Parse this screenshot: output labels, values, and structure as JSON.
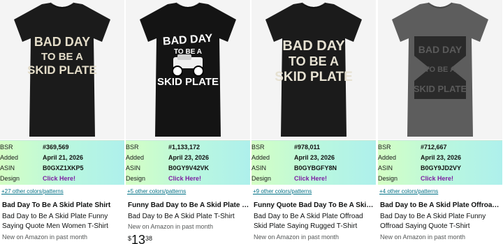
{
  "products": [
    {
      "shirt_color": "#1b1b1b",
      "design_lines": [
        "BAD DAY",
        "TO BE A",
        "SKID PLATE"
      ],
      "stats": {
        "bsr_label": "BSR",
        "bsr": "#369,569",
        "added_label": "Added",
        "added": "April 21, 2026",
        "asin_label": "ASIN",
        "asin": "B0GXZ1XKP5",
        "design_label": "Design",
        "design_link": "Click Here!"
      },
      "colors_link": "+27 other colors/patterns",
      "title_bold": "Bad Day To Be A Skid Plate Shirt",
      "title_sub": "Bad Day to Be A Skid Plate Funny Saying Quote Men Women T-Shirt",
      "new_text": "New on Amazon in past month"
    },
    {
      "shirt_color": "#141414",
      "design_lines": [
        "BAD DAY",
        "TO BE A",
        "SKID PLATE"
      ],
      "stats": {
        "bsr_label": "BSR",
        "bsr": "#1,133,172",
        "added_label": "Added",
        "added": "April 23, 2026",
        "asin_label": "ASIN",
        "asin": "B0GY9V42VK",
        "design_label": "Design",
        "design_link": "Click Here!"
      },
      "colors_link": "+5 other colors/patterns",
      "title_bold": "Funny Bad Day to Be A Skid Plate Tee",
      "title_sub": "Bad Day to Be A Skid Plate T-Shirt",
      "new_text": "New on Amazon in past month",
      "price": {
        "symbol": "$",
        "whole": "13",
        "fraction": "38"
      }
    },
    {
      "shirt_color": "#1b1b1b",
      "design_lines": [
        "BAD DAY",
        "TO BE A",
        "SKID PLATE"
      ],
      "stats": {
        "bsr_label": "BSR",
        "bsr": "#978,011",
        "added_label": "Added",
        "added": "April 23, 2026",
        "asin_label": "ASIN",
        "asin": "B0GYBGFY8N",
        "design_label": "Design",
        "design_link": "Click Here!"
      },
      "colors_link": "+9 other colors/patterns",
      "title_bold": "Funny Quote Bad Day To Be A Skid Plate Shirt",
      "title_sub": "Bad Day to Be A Skid Plate Offroad Skid Plate Saying Rugged T-Shirt",
      "new_text": "New on Amazon in past month"
    },
    {
      "shirt_color": "#5d5d5d",
      "design_lines": [
        "BAD DAY",
        "TO BE A",
        "SKID PLATE"
      ],
      "stats": {
        "bsr_label": "BSR",
        "bsr": "#712,667",
        "added_label": "Added",
        "added": "April 23, 2026",
        "asin_label": "ASIN",
        "asin": "B0GY9JD2VY",
        "design_label": "Design",
        "design_link": "Click Here!"
      },
      "colors_link": "+4 other colors/patterns",
      "title_bold": "Bad Day to Be A Skid Plate Offroad Shirt",
      "title_sub": "Bad Day to Be A Skid Plate Funny Offroad Saying Quote T-Shirt",
      "new_text": "New on Amazon in past month"
    }
  ]
}
